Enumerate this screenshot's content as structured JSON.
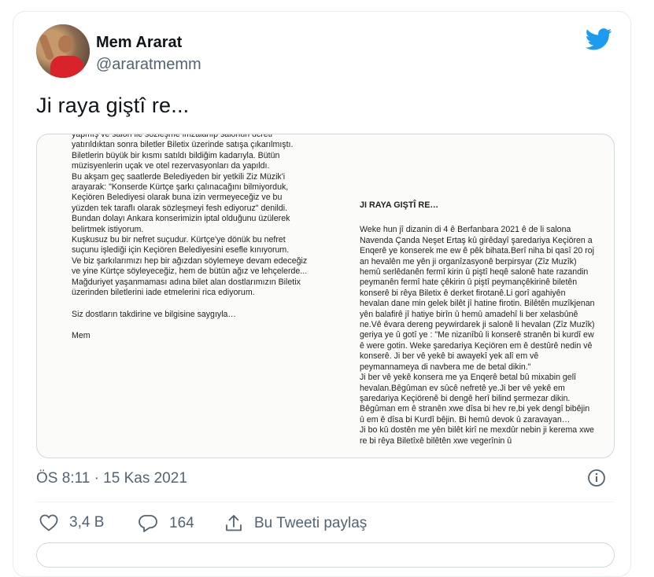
{
  "colors": {
    "brand": "#1d9bf0",
    "text": "#0f1419",
    "muted": "#536471"
  },
  "user": {
    "display_name": "Mem Ararat",
    "handle": "@araratmemm",
    "avatar_icon": "avatar"
  },
  "tweet": {
    "text": "Ji raya giştî re..."
  },
  "media": {
    "left_page": {
      "paragraphs": [
        "yapmış ve salon ile sözleşme imzalanıp salonun ücreti yatırıldıktan sonra biletler Biletix üzerinde satışa çıkarılmıştı. Biletlerin büyük bir kısmı satıldı bildiğim kadarıyla. Bütün müzisyenlerin uçak ve otel rezervasyonları da yapıldı.\nBu akşam geç saatlerde Belediyeden bir yetkili Ziz Müzik'i arayarak: \"Konserde Kürtçe şarkı çalınacağını bilmiyorduk, Keçiören Belediyesi olarak buna izin vermeyeceğiz ve bu yüzden tek taraflı olarak sözleşmeyi fesh ediyoruz\" denildi. Bundan dolayı Ankara konserimizin iptal olduğunu üzülerek belirtmek istiyorum.\nKuşkusuz bu bir nefret suçudur. Kürtçe'ye dönük bu nefret suçunu işlediği için Keçiören Belediyesini esefle kınıyorum.\nVe biz şarkılarımızı hep bir ağızdan söylemeye devam edeceğiz ve yine Kürtçe söyleyeceğiz, hem de bütün ağız ve lehçelerde...\nMağduriyet yaşanmaması adına bilet alan dostlarımızın Biletix üzerinden biletlerini iade etmelerini rica ediyorum.",
        "Siz dostların takdirine ve bilgisine saygıyla…",
        "Mem"
      ]
    },
    "right_page": {
      "heading": "JI RAYA GIŞTÎ RE…",
      "body": "Weke hun jî dizanin di 4 ê Berfanbara 2021 ê de li salona Navenda Çanda Neşet Ertaş kû girêdayî şaredariya Keçiören a Enqerê ye konserek me ew ê pêk bihata.Berî niha bi qasî 20 roj an hevalên me yên ji organîzasyonê berpirsyar (Zîz Muzîk) hemû serlêdanên fermî kirin û piştî heqê salonê hate razandin peymanên fermî hate çêkirin û piştî peymançêkirinê biletên konserê bi rêya Biletix ê derket firotanê.Li gorî agahiyên hevalan dane min gelek bilêt jî hatine firotin. Bilêtên muzîkjenan yên balafirê jî hatiye birîn û hemû amadehî li ber xelasbûnê ne.Vê êvara dereng peywirdarek ji salonê li hevalan (Zîz Muzîk) geriya ye û gotî ye : \"Me nizanîbû li konserê stranên bi kurdî ew ê were gotin. Weke şaredariya Keçiören em ê destûrê nedin vê konserê. Ji ber vê yekê bi awayekî yek alî em vê peymannameya di navbera me de betal dikin.\"\nJi ber vê yekê konsera me ya Enqerê betal bû mixabin gelî hevalan.Bêgûman ev sûcê nefretê ye.Ji ber vê yekê em şaredariya Keçiörenê bi dengê herî bilind şermezar dikin. Bêgûman em ê stranên xwe dîsa bi hev re,bi yek dengî bibêjin û em ê dîsa bi Kurdî bêjin. Bi hemû devok û zaravayan…\nJi bo kû dostên me yên bilêt kirî ne mexdûr nebin ji kerema xwe re bi rêya Biletîxê bilêtên xwe vegerînin û"
    }
  },
  "timestamp": "ÖS 8:11 · 15 Kas 2021",
  "actions": {
    "like_count": "3,4 B",
    "reply_count": "164",
    "share_label": "Bu Tweeti paylaş"
  }
}
